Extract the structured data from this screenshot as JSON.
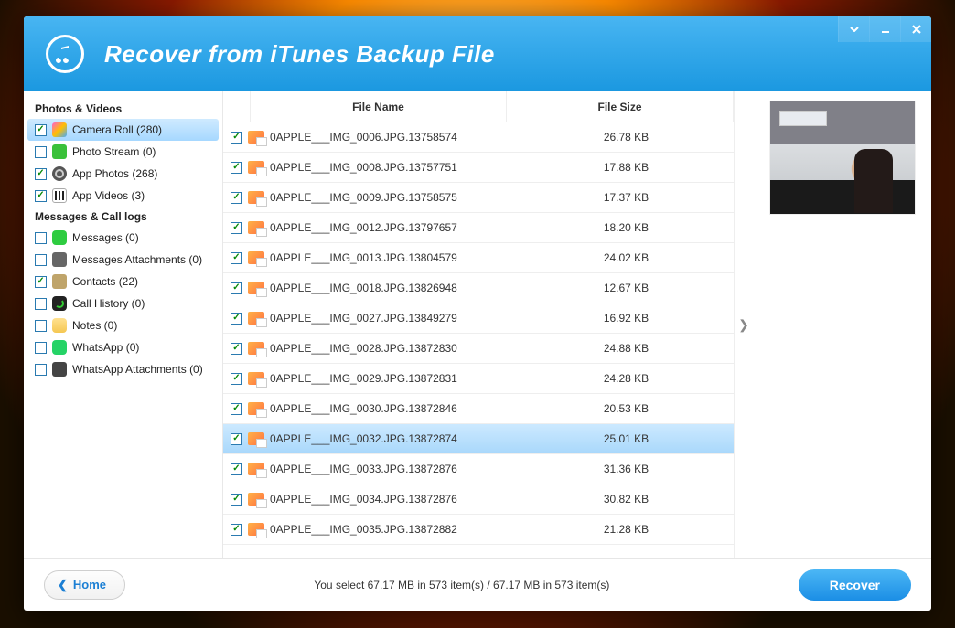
{
  "title": "Recover from iTunes Backup File",
  "sidebar": {
    "sections": [
      {
        "heading": "Photos & Videos",
        "items": [
          {
            "label": "Camera Roll (280)",
            "checked": true,
            "icon": "ic-camera",
            "selected": true
          },
          {
            "label": "Photo Stream (0)",
            "checked": false,
            "icon": "ic-photostream",
            "selected": false
          },
          {
            "label": "App Photos (268)",
            "checked": true,
            "icon": "ic-appphotos",
            "selected": false
          },
          {
            "label": "App Videos (3)",
            "checked": true,
            "icon": "ic-appvideos",
            "selected": false
          }
        ]
      },
      {
        "heading": "Messages & Call logs",
        "items": [
          {
            "label": "Messages (0)",
            "checked": false,
            "icon": "ic-messages",
            "selected": false
          },
          {
            "label": "Messages Attachments (0)",
            "checked": false,
            "icon": "ic-msgattach",
            "selected": false
          },
          {
            "label": "Contacts (22)",
            "checked": true,
            "icon": "ic-contacts",
            "selected": false
          },
          {
            "label": "Call History (0)",
            "checked": false,
            "icon": "ic-callhist",
            "selected": false
          },
          {
            "label": "Notes (0)",
            "checked": false,
            "icon": "ic-notes",
            "selected": false
          },
          {
            "label": "WhatsApp (0)",
            "checked": false,
            "icon": "ic-whatsapp",
            "selected": false
          },
          {
            "label": "WhatsApp Attachments (0)",
            "checked": false,
            "icon": "ic-waattach",
            "selected": false
          }
        ]
      }
    ]
  },
  "table": {
    "headers": {
      "name": "File Name",
      "size": "File Size"
    },
    "rows": [
      {
        "name": "0APPLE___IMG_0006.JPG.13758574",
        "size": "26.78 KB",
        "checked": true,
        "selected": false
      },
      {
        "name": "0APPLE___IMG_0008.JPG.13757751",
        "size": "17.88 KB",
        "checked": true,
        "selected": false
      },
      {
        "name": "0APPLE___IMG_0009.JPG.13758575",
        "size": "17.37 KB",
        "checked": true,
        "selected": false
      },
      {
        "name": "0APPLE___IMG_0012.JPG.13797657",
        "size": "18.20 KB",
        "checked": true,
        "selected": false
      },
      {
        "name": "0APPLE___IMG_0013.JPG.13804579",
        "size": "24.02 KB",
        "checked": true,
        "selected": false
      },
      {
        "name": "0APPLE___IMG_0018.JPG.13826948",
        "size": "12.67 KB",
        "checked": true,
        "selected": false
      },
      {
        "name": "0APPLE___IMG_0027.JPG.13849279",
        "size": "16.92 KB",
        "checked": true,
        "selected": false
      },
      {
        "name": "0APPLE___IMG_0028.JPG.13872830",
        "size": "24.88 KB",
        "checked": true,
        "selected": false
      },
      {
        "name": "0APPLE___IMG_0029.JPG.13872831",
        "size": "24.28 KB",
        "checked": true,
        "selected": false
      },
      {
        "name": "0APPLE___IMG_0030.JPG.13872846",
        "size": "20.53 KB",
        "checked": true,
        "selected": false
      },
      {
        "name": "0APPLE___IMG_0032.JPG.13872874",
        "size": "25.01 KB",
        "checked": true,
        "selected": true
      },
      {
        "name": "0APPLE___IMG_0033.JPG.13872876",
        "size": "31.36 KB",
        "checked": true,
        "selected": false
      },
      {
        "name": "0APPLE___IMG_0034.JPG.13872876",
        "size": "30.82 KB",
        "checked": true,
        "selected": false
      },
      {
        "name": "0APPLE___IMG_0035.JPG.13872882",
        "size": "21.28 KB",
        "checked": true,
        "selected": false
      }
    ]
  },
  "footer": {
    "home": "Home",
    "status": "You select 67.17 MB in 573 item(s) / 67.17 MB in 573 item(s)",
    "recover": "Recover"
  }
}
